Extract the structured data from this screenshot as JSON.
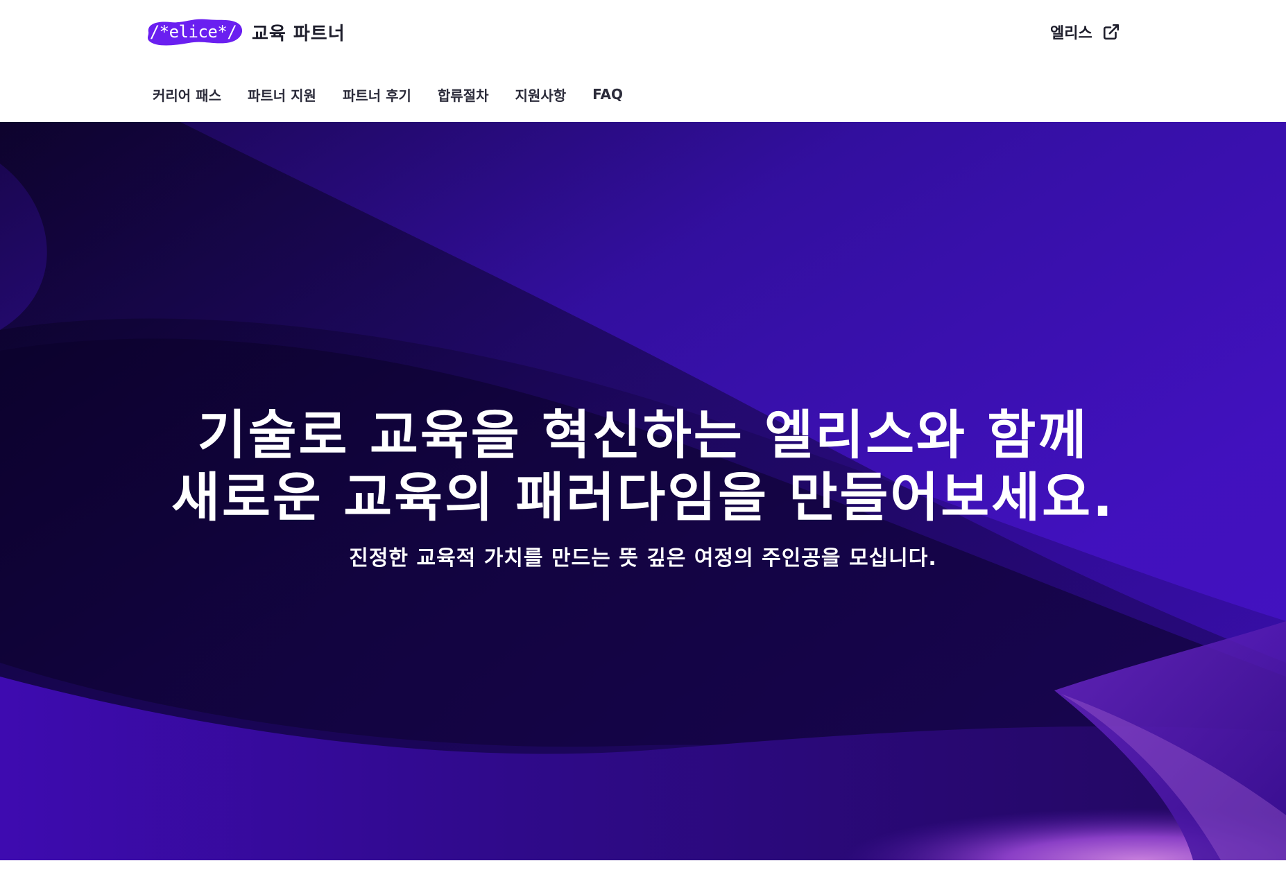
{
  "header": {
    "logo_text": "/*elice*/",
    "brand_title": "교육 파트너",
    "external_link_label": "엘리스",
    "external_icon": "external-link-icon"
  },
  "nav": {
    "items": [
      {
        "label": "커리어 패스"
      },
      {
        "label": "파트너 지원"
      },
      {
        "label": "파트너 후기"
      },
      {
        "label": "합류절차"
      },
      {
        "label": "지원사항"
      },
      {
        "label": "FAQ"
      }
    ]
  },
  "hero": {
    "title_line1": "기술로 교육을 혁신하는 엘리스와 함께",
    "title_line2": "새로운 교육의 패러다임을 만들어보세요.",
    "subtitle": "진정한 교육적 가치를 만드는 뜻 깊은 여정의 주인공을 모십니다."
  },
  "colors": {
    "brand_purple": "#5b1fe6",
    "hero_dark": "#13043f",
    "hero_mid": "#3a0ea8",
    "hero_light": "#a45ad0",
    "text_dark": "#1d1d2b"
  }
}
